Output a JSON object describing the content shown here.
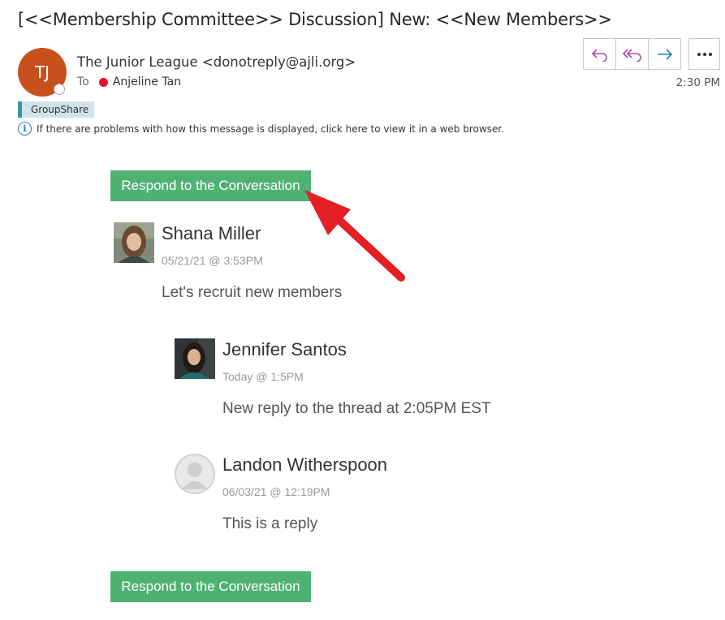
{
  "email": {
    "subject": "[<<Membership Committee>> Discussion] New: <<New Members>>",
    "sender_initials": "TJ",
    "sender": "The Junior League <donotreply@ajli.org>",
    "to_label": "To",
    "recipient": "Anjeline Tan",
    "time": "2:30 PM",
    "tag": "GroupShare",
    "info_text": "If there are problems with how this message is displayed, click here to view it in a web browser."
  },
  "toolbar": {
    "reply_icon": "reply-icon",
    "reply_all_icon": "reply-all-icon",
    "forward_icon": "forward-icon",
    "more_icon": "more-icon"
  },
  "body": {
    "respond_label": "Respond to the Conversation",
    "posts": [
      {
        "name": "Shana Miller",
        "date": "05/21/21 @ 3:53PM",
        "message": "Let's recruit new members"
      },
      {
        "name": "Jennifer Santos",
        "date": "Today @ 1:5PM",
        "message": "New reply to the thread at 2:05PM EST"
      },
      {
        "name": "Landon Witherspoon",
        "date": "06/03/21 @ 12:19PM",
        "message": "This is a reply"
      }
    ]
  },
  "colors": {
    "avatar": "#c8501d",
    "button_green": "#4fb172",
    "arrow_red": "#e31e24",
    "tag_accent": "#3d95a9"
  }
}
